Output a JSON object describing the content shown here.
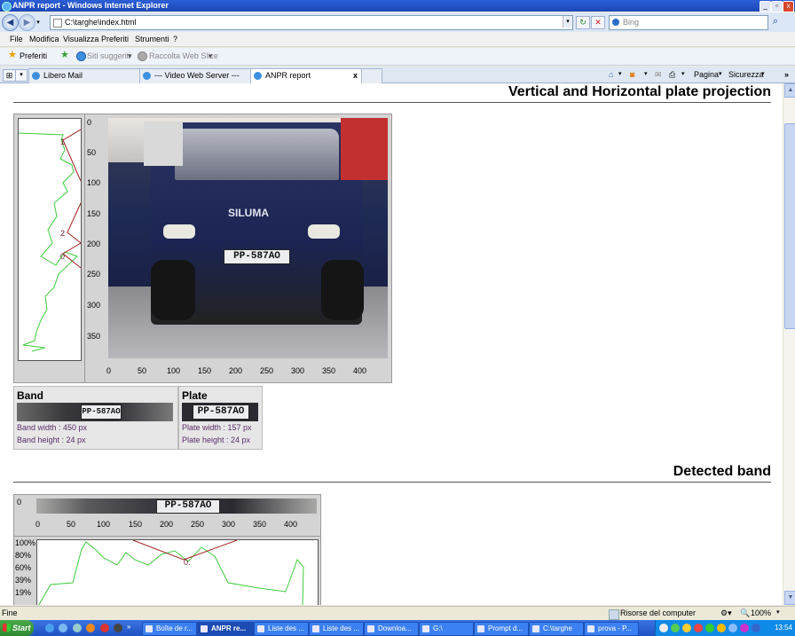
{
  "window": {
    "title": "ANPR report - Windows Internet Explorer"
  },
  "address": {
    "url": "C:\\targhe\\index.html",
    "search_placeholder": "Bing"
  },
  "menu": [
    "File",
    "Modifica",
    "Visualizza",
    "Preferiti",
    "Strumenti",
    "?"
  ],
  "favorites": {
    "label": "Preferiti",
    "items": [
      "Siti suggeriti",
      "Raccolta Web Slice"
    ]
  },
  "tabs": [
    {
      "label": "Libero Mail"
    },
    {
      "label": "--- Video Web Server ---"
    },
    {
      "label": "ANPR report",
      "active": true,
      "close": "x"
    }
  ],
  "commandbar": {
    "page": "Pagina",
    "security": "Sicurezza"
  },
  "report": {
    "section1_title": "Vertical and Horizontal plate projection",
    "section2_title": "Detected band",
    "plate_text": "PP-587AO",
    "vgraph_peaks": [
      "1",
      "2",
      "0"
    ],
    "photo_y_ticks": [
      "0",
      "50",
      "100",
      "150",
      "200",
      "250",
      "300",
      "350"
    ],
    "photo_x_ticks": [
      "0",
      "50",
      "100",
      "150",
      "200",
      "250",
      "300",
      "350",
      "400"
    ],
    "photo_text": "SILUMA",
    "band": {
      "title": "Band",
      "width": "Band width : 450 px",
      "height": "Band height : 24 px"
    },
    "plate": {
      "title": "Plate",
      "width": "Plate width : 157 px",
      "height": "Plate height : 24 px"
    },
    "band_y_tick": "0",
    "band_x_ticks": [
      "0",
      "50",
      "100",
      "150",
      "200",
      "250",
      "300",
      "350",
      "400"
    ],
    "hgraph_y_ticks": [
      "100%",
      "80%",
      "60%",
      "39%",
      "19%"
    ],
    "hgraph_peak": "0."
  },
  "status": {
    "left": "Fine",
    "zone": "Risorse del computer",
    "zoom": "100%"
  },
  "taskbar": {
    "start": "Start",
    "buttons": [
      "Boîte de r...",
      "ANPR re...",
      "Liste des ...",
      "Liste des ...",
      "Downloa...",
      "G:\\",
      "Prompt d...",
      "C:\\targhe",
      "prova - P..."
    ],
    "clock": "13:54"
  }
}
